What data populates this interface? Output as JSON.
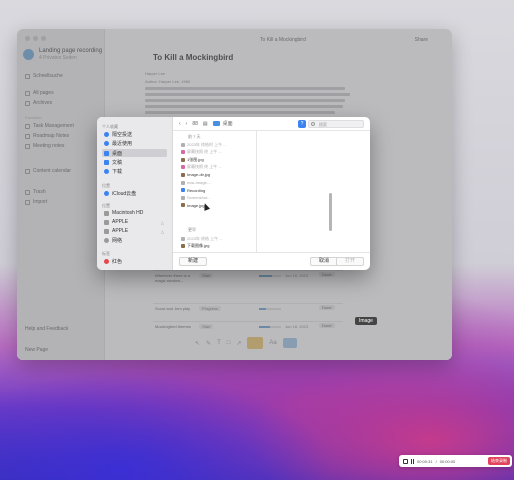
{
  "workspace": {
    "name": "Landing page recording",
    "subtitle": "4 Privates Seiten"
  },
  "sidebar": {
    "search": "Schnellsuche",
    "items": [
      "All pages",
      "Archives"
    ],
    "section_label": "Favoriten",
    "pages": [
      "Task Management",
      "Roadmap Notes",
      "Meeting notes",
      "Content calendar"
    ],
    "footer_items": [
      "Trash",
      "Import"
    ],
    "help_label": "Help and Feedback",
    "new_page": "New Page"
  },
  "topbar": {
    "breadcrumb": "To Kill a Mockingbird",
    "share": "Share"
  },
  "doc": {
    "title": "To Kill a Mockingbird",
    "meta_1": "Harper Lee",
    "meta_2": "Author: Harper Lee, 1960"
  },
  "table_rows": [
    {
      "text": "Wherever there is a magic window...",
      "status": "Start",
      "progress": 0.6,
      "date": "Jun 18, 2023",
      "btn": "Done"
    },
    {
      "text": "Scout and Jem play",
      "status": "Progress",
      "progress": 0.3,
      "date": "",
      "btn": "Done"
    },
    {
      "text": "Mockingbird themes",
      "status": "Start",
      "progress": 0.5,
      "date": "Jun 18, 2023",
      "btn": "Done"
    }
  ],
  "image_tooltip": "Image",
  "dialog": {
    "sidebar": {
      "section_favorites": "个人收藏",
      "favorites": [
        {
          "label": "隔空投送",
          "icon": "airdrop-icon"
        },
        {
          "label": "最近使用",
          "icon": "clock-icon"
        },
        {
          "label": "桌面",
          "icon": "desktop-icon",
          "selected": true
        },
        {
          "label": "文稿",
          "icon": "document-icon"
        },
        {
          "label": "下载",
          "icon": "download-icon"
        }
      ],
      "section_locations": "位置",
      "locations": [
        {
          "label": "iCloud云盘",
          "icon": "cloud-icon"
        }
      ],
      "section_devices": "位置",
      "devices": [
        {
          "label": "Macintosh HD",
          "icon": "disk-icon"
        },
        {
          "label": "APPLE",
          "icon": "disk-icon",
          "count": "△"
        },
        {
          "label": "APPLE",
          "icon": "disk-icon",
          "count": "△"
        },
        {
          "label": "网络",
          "icon": "network-icon"
        }
      ],
      "section_tags": "标签",
      "tags": [
        {
          "label": "红色",
          "icon": "tag-icon"
        }
      ]
    },
    "toolbar": {
      "view": "88",
      "location": "桌面",
      "search_placeholder": "搜索",
      "help": "?"
    },
    "files_head_1": "前 7 天",
    "files": [
      {
        "name": "2023年 终结时 上午 ...",
        "dim": true,
        "icon": "gray"
      },
      {
        "name": "屏幕快照 终 上午 ...",
        "dim": true,
        "icon": "pink"
      },
      {
        "name": "1张图.jpg",
        "dim": false,
        "icon": "img"
      },
      {
        "name": "屏幕快照 终 上午 ...",
        "dim": true,
        "icon": "pink"
      },
      {
        "name": "Image-dir.jpg",
        "dim": false,
        "icon": "img"
      },
      {
        "name": "mac-image-...",
        "dim": true,
        "icon": "gray"
      },
      {
        "name": "Recording",
        "dim": false,
        "icon": "blue"
      },
      {
        "name": "Screenshot...",
        "dim": true,
        "icon": "gray"
      },
      {
        "name": "Image.jpg",
        "dim": false,
        "icon": "img"
      }
    ],
    "files_head_2": "更早",
    "files_later": [
      {
        "name": "2023年 终结 上午 ...",
        "dim": true,
        "icon": "gray"
      },
      {
        "name": "下载图像.jpg",
        "dim": false,
        "icon": "img"
      }
    ],
    "new_folder": "新建",
    "cancel": "取消",
    "open": "打开"
  },
  "recording": {
    "time_1": "00:00:31",
    "sep": "/",
    "time_2": "00:00:00",
    "end": "结束录制"
  }
}
